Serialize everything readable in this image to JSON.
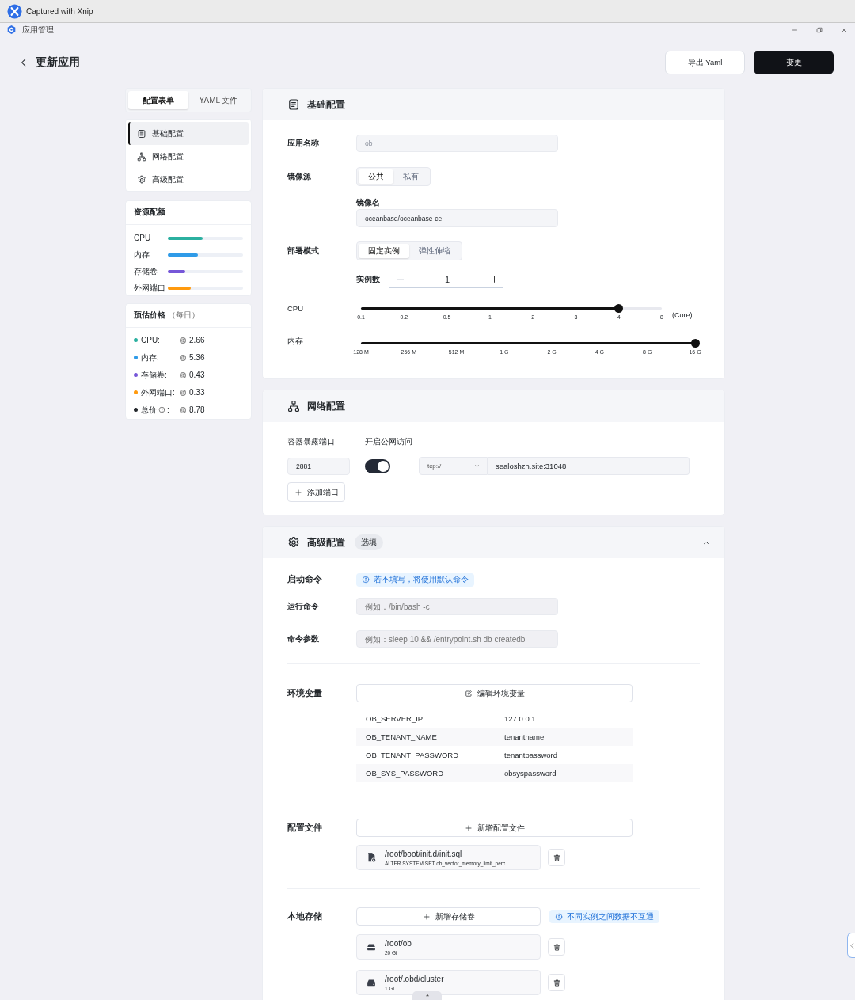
{
  "capture_bar": {
    "title": "Captured with Xnip"
  },
  "window": {
    "title": "应用管理"
  },
  "header": {
    "title": "更新应用",
    "buttons": [
      {
        "label": "导出 Yaml",
        "kind": "secondary"
      },
      {
        "label": "变更",
        "kind": "primary"
      }
    ]
  },
  "sidebar": {
    "tabs": [
      {
        "label": "配置表单",
        "selected": true
      },
      {
        "label": "YAML 文件",
        "selected": false
      }
    ],
    "nav": [
      {
        "label": "基础配置",
        "kind": "basic",
        "selected": true
      },
      {
        "label": "网络配置",
        "kind": "network",
        "selected": false
      },
      {
        "label": "高级配置",
        "kind": "advanced",
        "selected": false
      }
    ],
    "quota": {
      "title": "资源配额",
      "items": [
        {
          "label": "CPU",
          "level": 0.46,
          "color": "#2bb0a0"
        },
        {
          "label": "内存",
          "level": 0.4,
          "color": "#2f9be8"
        },
        {
          "label": "存储卷",
          "level": 0.23,
          "color": "#7657d8"
        },
        {
          "label": "外网端口",
          "level": 0.3,
          "color": "#ff9a0e"
        }
      ]
    },
    "price": {
      "title": "预估价格",
      "subtitle": "（每日）",
      "items": [
        {
          "label": "CPU:",
          "value": "2.66",
          "color": "#2bb0a0",
          "kind": "item"
        },
        {
          "label": "内存:",
          "value": "5.36",
          "color": "#2f9be8",
          "kind": "item"
        },
        {
          "label": "存储卷:",
          "value": "0.43",
          "color": "#7657d8",
          "kind": "item"
        },
        {
          "label": "外网端口:",
          "value": "0.33",
          "color": "#ff9a0e",
          "kind": "item"
        },
        {
          "label": "总价",
          "suffix": ":",
          "value": "8.78",
          "color": "#24282c",
          "kind": "total"
        }
      ]
    }
  },
  "basic": {
    "title": "基础配置",
    "app_name": {
      "label": "应用名称",
      "value": "ob",
      "disabled": true
    },
    "image_source": {
      "label": "镜像源",
      "options": [
        {
          "label": "公共",
          "selected": true
        },
        {
          "label": "私有",
          "selected": false
        }
      ]
    },
    "image_name": {
      "label": "镜像名",
      "value": "oceanbase/oceanbase-ce"
    },
    "deploy_mode": {
      "label": "部署模式",
      "options": [
        {
          "label": "固定实例",
          "selected": true
        },
        {
          "label": "弹性伸缩",
          "selected": false
        }
      ]
    },
    "replicas": {
      "label": "实例数",
      "value": "1"
    },
    "cpu": {
      "label": "CPU",
      "ticks": [
        "0.1",
        "0.2",
        "0.5",
        "1",
        "2",
        "3",
        "4",
        "8"
      ],
      "level": 0.857,
      "unit": "(Core)"
    },
    "memory": {
      "label": "内存",
      "ticks": [
        "128 M",
        "256 M",
        "512 M",
        "1 G",
        "2 G",
        "4 G",
        "8 G",
        "16 G"
      ],
      "level": 1
    }
  },
  "network": {
    "title": "网络配置",
    "port_label": "容器暴露端口",
    "public_label": "开启公网访问",
    "ports": [
      {
        "port": "2881",
        "public": true,
        "protocol": "tcp://",
        "domain": "sealoshzh.site:31048"
      }
    ],
    "add_button": "添加端口"
  },
  "advanced": {
    "title": "高级配置",
    "badge": "选填",
    "expanded": true,
    "startup": {
      "label": "启动命令",
      "hint": "若不填写，将使用默认命令"
    },
    "run_command": {
      "label": "运行命令",
      "placeholder": "例如：/bin/bash -c"
    },
    "args": {
      "label": "命令参数",
      "placeholder": "例如：sleep 10 && /entrypoint.sh db createdb"
    },
    "env": {
      "label": "环境变量",
      "edit_button": "编辑环境变量",
      "vars": [
        {
          "name": "OB_SERVER_IP",
          "value": "127.0.0.1"
        },
        {
          "name": "OB_TENANT_NAME",
          "value": "tenantname"
        },
        {
          "name": "OB_TENANT_PASSWORD",
          "value": "tenantpassword"
        },
        {
          "name": "OB_SYS_PASSWORD",
          "value": "obsyspassword"
        }
      ]
    },
    "config_files": {
      "label": "配置文件",
      "add_button": "新增配置文件",
      "files": [
        {
          "path": "/root/boot/init.d/init.sql",
          "content": "ALTER SYSTEM SET ob_vector_memory_limit_perc…"
        }
      ]
    },
    "storage": {
      "label": "本地存储",
      "add_button": "新增存储卷",
      "hint": "不同实例之间数据不互通",
      "volumes": [
        {
          "path": "/root/ob",
          "size": "20 Gi"
        },
        {
          "path": "/root/.obd/cluster",
          "size": "1 Gi"
        }
      ]
    }
  }
}
